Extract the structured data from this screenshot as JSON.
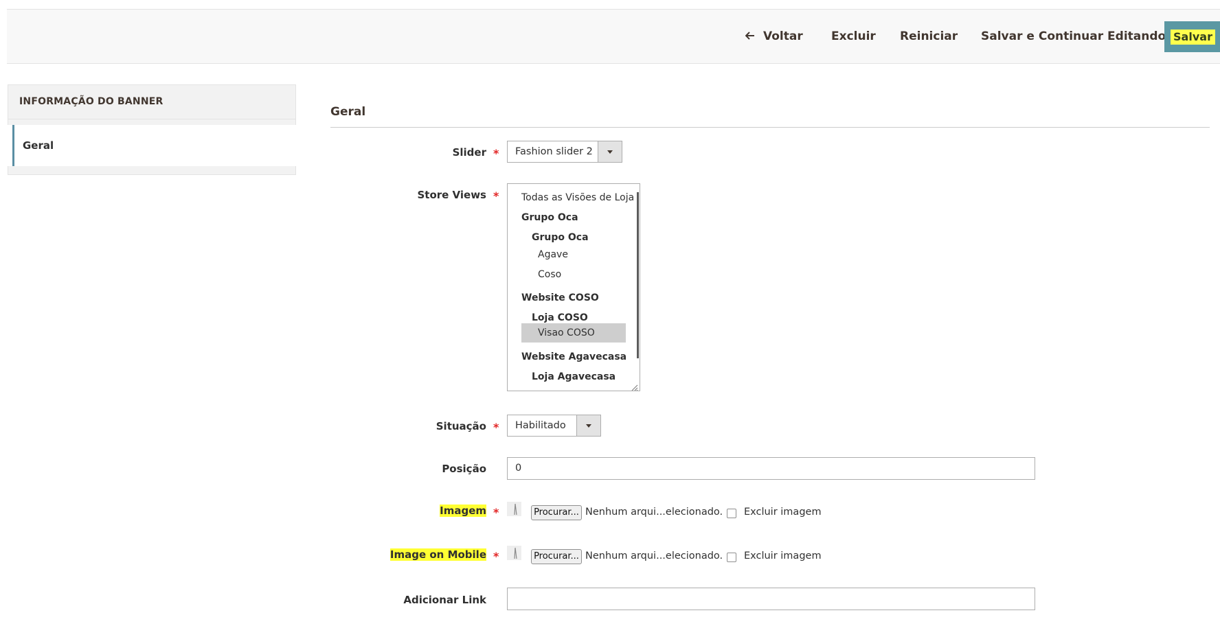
{
  "toolbar": {
    "back_label": "Voltar",
    "delete_label": "Excluir",
    "reset_label": "Reiniciar",
    "save_continue_label": "Salvar e Continuar Editando",
    "save_label": "Salvar",
    "accent_color": "#5b98a3",
    "highlight_color": "#ffff33"
  },
  "sidebar": {
    "title": "INFORMAÇÃO DO BANNER",
    "items": [
      {
        "label": "Geral",
        "active": true
      }
    ]
  },
  "form": {
    "section_title": "Geral",
    "slider": {
      "label": "Slider",
      "value": "Fashion slider 2",
      "required": true
    },
    "store_views": {
      "label": "Store Views",
      "required": true,
      "options": [
        {
          "text": "Todas as Visões de Loja",
          "type": "option"
        },
        {
          "text": "Grupo Oca",
          "type": "website"
        },
        {
          "text": "Grupo Oca",
          "type": "store"
        },
        {
          "text": "Agave",
          "type": "view"
        },
        {
          "text": "Coso",
          "type": "view"
        },
        {
          "text": "Website COSO",
          "type": "website"
        },
        {
          "text": "Loja COSO",
          "type": "store"
        },
        {
          "text": "Visao COSO",
          "type": "view",
          "selected": true
        },
        {
          "text": "Website Agavecasa",
          "type": "website"
        },
        {
          "text": "Loja Agavecasa",
          "type": "store"
        }
      ]
    },
    "status": {
      "label": "Situação",
      "value": "Habilitado",
      "required": true
    },
    "position": {
      "label": "Posição",
      "value": "0"
    },
    "image": {
      "label": "Imagem",
      "required": true,
      "browse_label": "Procurar...",
      "file_text": "Nenhum arqui...elecionado.",
      "delete_label": "Excluir imagem"
    },
    "image_mobile": {
      "label": "Image on Mobile",
      "required": true,
      "browse_label": "Procurar...",
      "file_text": "Nenhum arqui...elecionado.",
      "delete_label": "Excluir imagem"
    },
    "link": {
      "label": "Adicionar Link",
      "value": ""
    }
  }
}
